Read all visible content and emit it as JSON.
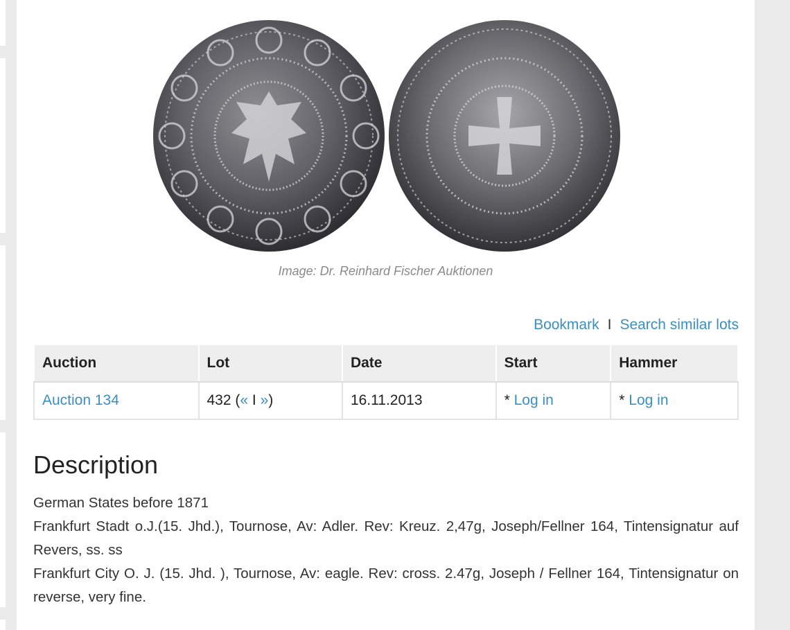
{
  "image": {
    "credit": "Image: Dr. Reinhard Fischer Auktionen",
    "obverse_icon": "coin-obverse-eagle",
    "reverse_icon": "coin-reverse-cross"
  },
  "actions": {
    "bookmark": "Bookmark",
    "separator": "I",
    "search_similar": "Search similar lots"
  },
  "table": {
    "headers": [
      "Auction",
      "Lot",
      "Date",
      "Start",
      "Hammer"
    ],
    "row": {
      "auction": "Auction 134",
      "lot_number": "432",
      "lot_open": "(",
      "prev": "«",
      "nav_sep": "I",
      "next": "»",
      "lot_close": ")",
      "date": "16.11.2013",
      "start_prefix": "*",
      "start_login": "Log in",
      "hammer_prefix": "*",
      "hammer_login": "Log in"
    }
  },
  "description": {
    "title": "Description",
    "category": "German States before 1871",
    "text_de": "Frankfurt Stadt o.J.(15. Jhd.), Tournose, Av: Adler. Rev: Kreuz. 2,47g, Joseph/Fellner 164, Tintensignatur auf Revers, ss. ss",
    "text_en": "Frankfurt City O. J. (15. Jhd. ), Tournose, Av: eagle. Rev: cross. 2.47g, Joseph / Fellner 164, Tintensignatur on reverse, very fine."
  },
  "colors": {
    "link": "#3a8fc2",
    "background": "#ebebeb",
    "header_cell": "#eeeeee"
  }
}
